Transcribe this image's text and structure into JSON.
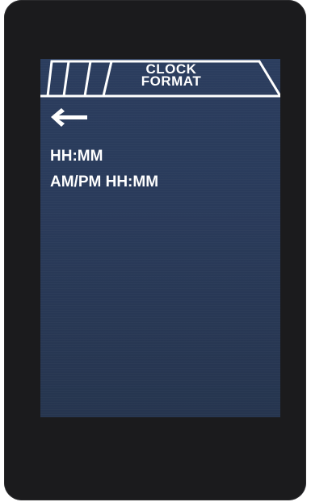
{
  "header": {
    "title": "CLOCK\nFORMAT"
  },
  "icons": {
    "back": "arrow-left-icon"
  },
  "options": [
    {
      "label": "HH:MM"
    },
    {
      "label": "AM/PM HH:MM"
    }
  ],
  "colors": {
    "screen_background": "#2a3b5b",
    "text": "#ffffff",
    "bezel": "#1b1b1d"
  }
}
